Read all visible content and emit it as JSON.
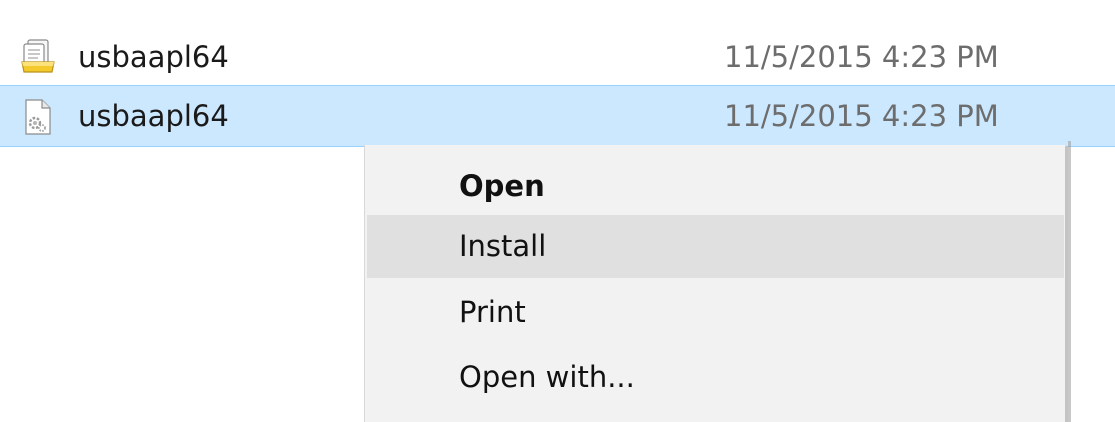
{
  "files": [
    {
      "name": "usbaapl64",
      "date": "11/5/2015 4:23 PM",
      "icon": "setup-information-file-icon",
      "selected": false
    },
    {
      "name": "usbaapl64",
      "date": "11/5/2015 4:23 PM",
      "icon": "system-file-icon",
      "selected": true
    }
  ],
  "context_menu": {
    "items": [
      {
        "label": "Open",
        "default": true
      },
      {
        "label": "Install",
        "hovered": true
      },
      {
        "label": "Print"
      },
      {
        "label": "Open with..."
      }
    ]
  },
  "colors": {
    "selection_bg": "#cce8ff",
    "selection_border": "#99d1ff",
    "menu_bg": "#f2f2f2",
    "menu_hover_bg": "#e0e0e0",
    "date_text": "#6d6d6d"
  }
}
